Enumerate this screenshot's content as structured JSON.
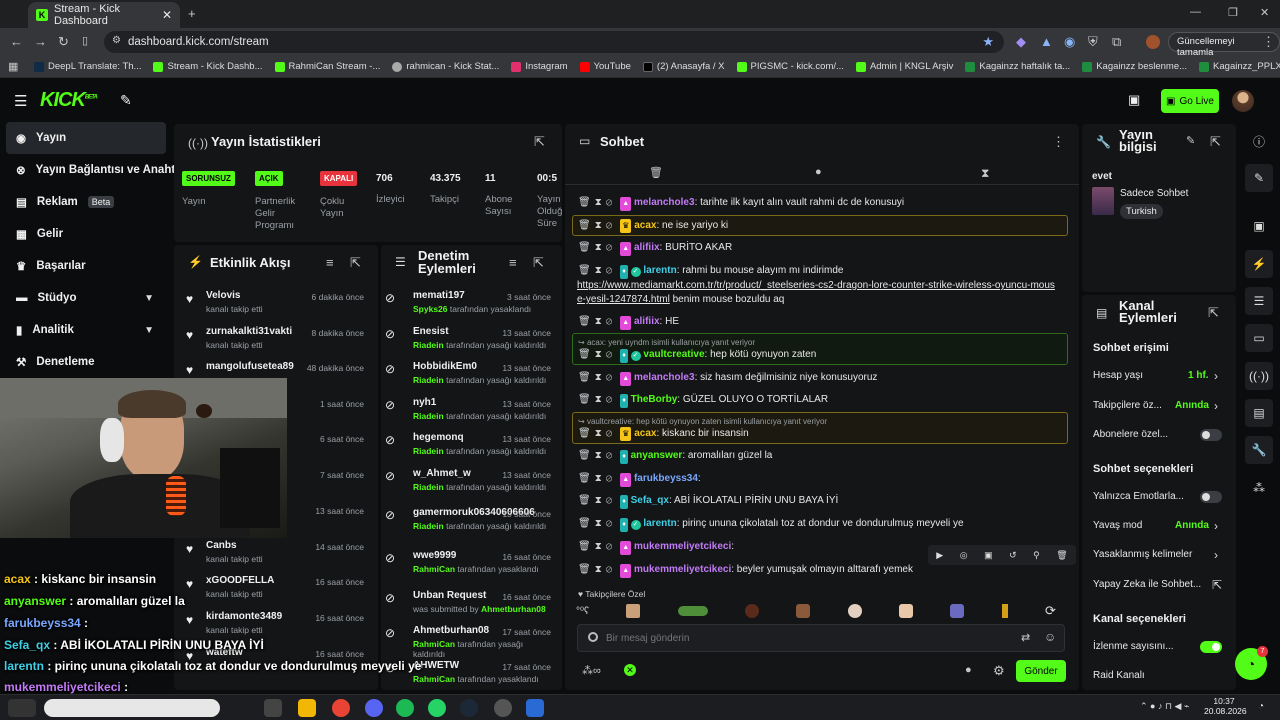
{
  "browser": {
    "tab_title": "Stream - Kick Dashboard",
    "url": "dashboard.kick.com/stream",
    "update_label": "Güncellemeyi tamamla",
    "bookmarks": [
      "DeepL Translate: Th...",
      "Stream - Kick Dashb...",
      "RahmiCan Stream -...",
      "rahmican - Kick Stat...",
      "Instagram",
      "YouTube",
      "(2) Anasayfa / X",
      "PIGSMC - kick.com/...",
      "Admin | KNGL Arşiv",
      "Kagainzz haftalık ta...",
      "Kagainzz beslenme...",
      "Kagainzz_PPLXUL -..."
    ]
  },
  "header": {
    "logo": "KICK",
    "logo_sup": "BETA",
    "go_live": "Go Live"
  },
  "sidebar": {
    "items": [
      {
        "label": "Yayın",
        "icon": "broadcast-icon"
      },
      {
        "label": "Yayın Bağlantısı ve Anahtarı",
        "icon": "link-icon"
      },
      {
        "label": "Reklam",
        "badge": "Beta",
        "icon": "ad-icon"
      },
      {
        "label": "Gelir",
        "icon": "wallet-icon"
      },
      {
        "label": "Başarılar",
        "icon": "trophy-icon"
      },
      {
        "label": "Stüdyo",
        "icon": "studio-icon"
      },
      {
        "label": "Analitik",
        "icon": "chart-icon"
      },
      {
        "label": "Denetleme",
        "icon": "gavel-icon"
      }
    ]
  },
  "stats": {
    "title": "Yayın İstatistikleri",
    "cols": [
      {
        "value": "SORUNSUZ",
        "label": "Yayın"
      },
      {
        "value": "AÇIK",
        "label": "Partnerlik Gelir Programı"
      },
      {
        "value": "KAPALI",
        "label": "Çoklu Yayın"
      },
      {
        "value": "706",
        "label": "İzleyici"
      },
      {
        "value": "43.375",
        "label": "Takipçi"
      },
      {
        "value": "11",
        "label": "Abone Sayısı"
      },
      {
        "value": "00:5",
        "label": "Yayın Olduğu Süre"
      }
    ]
  },
  "activity": {
    "title": "Etkinlik Akışı",
    "items": [
      {
        "name": "Velovis",
        "sub": "kanalı takip etti",
        "time": "6 dakika önce"
      },
      {
        "name": "zurnakalkti31vakti",
        "sub": "kanalı takip etti",
        "time": "8 dakika önce"
      },
      {
        "name": "mangolufusetea89",
        "sub": "",
        "time": "48 dakika önce"
      },
      {
        "name": "",
        "sub": "",
        "time": "1 saat önce"
      },
      {
        "name": "",
        "sub": "",
        "time": "6 saat önce"
      },
      {
        "name": "",
        "sub": "",
        "time": "7 saat önce"
      },
      {
        "name": "",
        "sub": "",
        "time": "13 saat önce"
      },
      {
        "name": "Canbs",
        "sub": "kanalı takip etti",
        "time": "14 saat önce"
      },
      {
        "name": "xGOODFELLA",
        "sub": "kanalı takip etti",
        "time": "16 saat önce"
      },
      {
        "name": "kirdamonte3489",
        "sub": "kanalı takip etti",
        "time": "16 saat önce"
      },
      {
        "name": "wateftw",
        "sub": "",
        "time": "16 saat önce"
      }
    ]
  },
  "moderation": {
    "title": "Denetim Eylemleri",
    "items": [
      {
        "name": "memati197",
        "by": "Spyks26",
        "action": "tarafından yasaklandı",
        "time": "3 saat önce"
      },
      {
        "name": "Enesist",
        "by": "Riadein",
        "action": "tarafından yasağı kaldırıldı",
        "time": "13 saat önce"
      },
      {
        "name": "HobbidikEm0",
        "by": "Riadein",
        "action": "tarafından yasağı kaldırıldı",
        "time": "13 saat önce"
      },
      {
        "name": "nyh1",
        "by": "Riadein",
        "action": "tarafından yasağı kaldırıldı",
        "time": "13 saat önce"
      },
      {
        "name": "hegemonq",
        "by": "Riadein",
        "action": "tarafından yasağı kaldırıldı",
        "time": "13 saat önce"
      },
      {
        "name": "w_Ahmet_w",
        "by": "Riadein",
        "action": "tarafından yasağı kaldırıldı",
        "time": "13 saat önce"
      },
      {
        "name": "gamermoruk06340606606",
        "by": "Riadein",
        "action": "tarafından yasağı kaldırıldı",
        "time": "13 saat önce"
      },
      {
        "name": "wwe9999",
        "by": "RahmiCan",
        "action": "tarafından yasaklandı",
        "time": "16 saat önce"
      },
      {
        "name": "Unban Request",
        "by": "Ahmetburhan08",
        "action": "was submitted by",
        "time": "16 saat önce"
      },
      {
        "name": "Ahmetburhan08",
        "by": "RahmiCan",
        "action": "tarafından yasağı kaldırıldı",
        "time": "17 saat önce"
      },
      {
        "name": "AHWETW",
        "by": "RahmiCan",
        "action": "tarafından yasaklandı",
        "time": "17 saat önce"
      }
    ]
  },
  "chat": {
    "title": "Sohbet",
    "messages": [
      {
        "user": "melancholе3",
        "color": "#c27bf7",
        "text": ": tarihte ilk kayıt alın vault rahmi dc de konusuyi"
      },
      {
        "user": "acax",
        "color": "#f5c518",
        "text": ": ne ise yariyo ki"
      },
      {
        "user": "alifiix",
        "color": "#c27bf7",
        "text": ": BURİTO AKAR"
      },
      {
        "user": "larentn",
        "color": "#3fd0e8",
        "text": ": rahmi bu mouse alayım mı indirimde"
      },
      {
        "link": "https://www.mediamarkt.com.tr/tr/product/_steelseries-cs2-dragon-lore-counter-strike-wireless-oyuncu-mouse-yesil-1247874.html",
        "tail": " benim mouse bozuldu aq"
      },
      {
        "user": "alifiix",
        "color": "#c27bf7",
        "text": ": HE"
      },
      {
        "reply": "acax: yeni uyndm isimli kullanıcıya yanıt veriyor"
      },
      {
        "user": "vaultcreative",
        "color": "#53fc18",
        "text": ": hep kötü oynuyon zaten"
      },
      {
        "user": "melancholе3",
        "color": "#c27bf7",
        "text": ": siz hasım değilmisiniz niye konusuyoruz"
      },
      {
        "user": "TheBorby",
        "color": "#53fc18",
        "text": ": GÜZEL OLUYO O TORTİLALAR"
      },
      {
        "reply": "vaultcreative: hep kötü oynuyon zaten isimli kullanıcıya yanıt veriyor"
      },
      {
        "user": "acax",
        "color": "#f5c518",
        "text": ": kiskanc bir insansin"
      },
      {
        "user": "anyanswer",
        "color": "#53fc18",
        "text": ": aromalıları güzel la"
      },
      {
        "user": "farukbeyss34",
        "color": "#7aa7ff",
        "text": ":"
      },
      {
        "user": "Sefa_qx",
        "color": "#3fd0e8",
        "text": ": ABİ İKOLATALI PİRİN UNU BAYA İYİ"
      },
      {
        "user": "larentn",
        "color": "#3fd0e8",
        "text": ": pirinç ununa çikolatalı toz at dondur ve dondurulmuş meyveli ye"
      },
      {
        "user": "mukemmeliyetcikeci",
        "color": "#c27bf7",
        "text": ":"
      },
      {
        "user": "mukemmeliyetcikeci",
        "color": "#c27bf7",
        "text": ": beyler yumuşak olmayın alttarafı yemek"
      }
    ],
    "emote_label": "Takipçilere Özel",
    "input_placeholder": "Bir mesaj gönderin",
    "send_label": "Gönder"
  },
  "stream_info": {
    "title": "Yayın bilgisi",
    "stream_title": "evet",
    "category": "Sadece Sohbet",
    "language": "Turkish"
  },
  "channel_actions": {
    "title": "Kanal Eylemleri",
    "chat_access": "Sohbet erişimi",
    "account_age": {
      "label": "Hesap yaşı",
      "value": "1 hf."
    },
    "followers_only": {
      "label": "Takipçilere öz...",
      "value": "Anında"
    },
    "subs_only": {
      "label": "Abonelere özel..."
    },
    "chat_options": "Sohbet seçenekleri",
    "emotes_only": {
      "label": "Yalnızca Emotlarla..."
    },
    "slow_mode": {
      "label": "Yavaş mod",
      "value": "Anında"
    },
    "banned_words": {
      "label": "Yasaklanmış kelimeler"
    },
    "ai_chat": {
      "label": "Yapay Zeka ile Sohbet..."
    },
    "channel_options": "Kanal seçenekleri",
    "viewer_count": {
      "label": "İzlenme sayısını..."
    },
    "raid": {
      "label": "Raid Kanalı"
    },
    "notif_count": "7"
  },
  "overlay": [
    {
      "user": "acax",
      "color": "#f5c518",
      "text": " : kiskanc bir insansin"
    },
    {
      "user": "anyanswer",
      "color": "#53fc18",
      "text": " : aromalıları güzel la"
    },
    {
      "user": "farukbeyss34",
      "color": "#7aa7ff",
      "text": " :"
    },
    {
      "user": "Sefa_qx",
      "color": "#3fd0e8",
      "text": " : ABİ İKOLATALI PİRİN UNU BAYA İYİ"
    },
    {
      "user": "larentn",
      "color": "#3fd0e8",
      "text": " : pirinç ununa çikolatalı toz at dondur ve dondurulmuş meyveli ye"
    },
    {
      "user": "mukemmeliyetcikeci",
      "color": "#c27bf7",
      "text": " :"
    },
    {
      "user": "mukemmeliyetcikeci",
      "color": "#c27bf7",
      "text": " : beyler yumuşak olmayın alttarafı yemek"
    }
  ],
  "taskbar": {
    "time": "10:37",
    "date": "20.08.2026"
  }
}
